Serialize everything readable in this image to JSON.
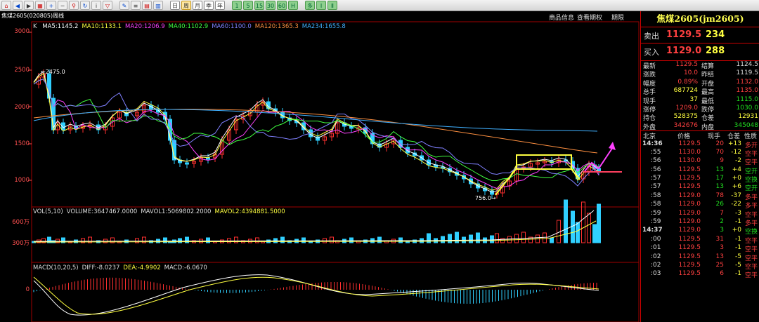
{
  "toolbar": {
    "icons": [
      "home-icon",
      "back-icon",
      "forward-icon",
      "grid-icon",
      "zoom-in-icon",
      "zoom-out-icon",
      "search-icon",
      "refresh-icon",
      "info-icon",
      "filter-icon",
      "tools-icon",
      "list-icon",
      "stats-icon",
      "calendar-icon"
    ],
    "periods": [
      "日",
      "周",
      "月",
      "季",
      "年",
      "1",
      "5",
      "15",
      "30",
      "60",
      "H",
      "多",
      "Ⅰ",
      "Ⅱ"
    ]
  },
  "header": {
    "symbol_label": "焦煤2605",
    "code": "(020805)",
    "period": "周线",
    "links": [
      "商品信息",
      "查看期权",
      "期限"
    ]
  },
  "main_indicators": {
    "prefix": "K",
    "items": [
      {
        "text": "MA5:1145.2",
        "color": "#ffffff"
      },
      {
        "text": "MA10:1133.1",
        "color": "#ffff40"
      },
      {
        "text": "MA20:1206.9",
        "color": "#ff40ff"
      },
      {
        "text": "MA40:1102.9",
        "color": "#40ff40"
      },
      {
        "text": "MA60:1100.0",
        "color": "#8080ff"
      },
      {
        "text": "MA120:1365.3",
        "color": "#ff9040"
      },
      {
        "text": "MA234:1655.8",
        "color": "#40b0ff"
      }
    ]
  },
  "price_axis": [
    "3000",
    "2500",
    "2000",
    "1500",
    "1000"
  ],
  "annotations": {
    "high": "2475.0",
    "low": "756.0"
  },
  "vol_indicators": {
    "items": [
      {
        "text": "VOL(5,10)",
        "color": "#dddddd"
      },
      {
        "text": "VOLUME:3647467.0000",
        "color": "#dddddd"
      },
      {
        "text": "MAVOL1:5069802.2000",
        "color": "#dddddd"
      },
      {
        "text": "MAVOL2:4394881.5000",
        "color": "#ffff40"
      }
    ],
    "axis": [
      "600万",
      "300万"
    ]
  },
  "macd_indicators": {
    "items": [
      {
        "text": "MACD(10,20,5)",
        "color": "#dddddd"
      },
      {
        "text": "DIFF:-8.0237",
        "color": "#dddddd"
      },
      {
        "text": "DEA:-4.9902",
        "color": "#ffff40"
      },
      {
        "text": "MACD:-6.0670",
        "color": "#dddddd"
      }
    ],
    "axis": [
      "0"
    ]
  },
  "colors": {
    "up": "#ff3030",
    "down": "#30d0ff",
    "accent": "#ffff40"
  },
  "quote_panel": {
    "title": "焦煤2605(jm2605)",
    "sell": {
      "label": "卖出",
      "price": "1129.5",
      "volume": "234"
    },
    "buy": {
      "label": "买入",
      "price": "1129.0",
      "volume": "288"
    },
    "stats": [
      {
        "l1": "最新",
        "v1": "1129.5",
        "c1": "red",
        "l2": "结算",
        "v2": "1124.5",
        "c2": "wht"
      },
      {
        "l1": "涨跌",
        "v1": "10.0",
        "c1": "red",
        "l2": "昨结",
        "v2": "1119.5",
        "c2": "wht"
      },
      {
        "l1": "幅度",
        "v1": "0.89%",
        "c1": "red",
        "l2": "开盘",
        "v2": "1132.0",
        "c2": "red"
      },
      {
        "l1": "总手",
        "v1": "687724",
        "c1": "yel",
        "l2": "最高",
        "v2": "1135.0",
        "c2": "red"
      },
      {
        "l1": "现手",
        "v1": "37",
        "c1": "yel",
        "l2": "最低",
        "v2": "1115.0",
        "c2": "grn"
      },
      {
        "l1": "涨停",
        "v1": "1209.0",
        "c1": "red",
        "l2": "跌停",
        "v2": "1030.0",
        "c2": "grn"
      },
      {
        "l1": "持仓",
        "v1": "528375",
        "c1": "yel",
        "l2": "仓差",
        "v2": "12931",
        "c2": "yel"
      },
      {
        "l1": "外盘",
        "v1": "342676",
        "c1": "red",
        "l2": "内盘",
        "v2": "345048",
        "c2": "grn"
      }
    ],
    "ticks_header": [
      "北京",
      "价格",
      "现手",
      "仓差",
      "性质"
    ],
    "ticks": [
      {
        "time": "14:36",
        "price": "1129.5",
        "pc": "red",
        "hand": "20",
        "hc": "red",
        "diff": "+13",
        "dc": "yel",
        "nature": "多开",
        "nc": "red",
        "bold": true
      },
      {
        "time": ":55",
        "price": "1130.0",
        "pc": "red",
        "hand": "70",
        "hc": "red",
        "diff": "-12",
        "dc": "yel",
        "nature": "空平",
        "nc": "red"
      },
      {
        "time": ":56",
        "price": "1130.0",
        "pc": "red",
        "hand": "9",
        "hc": "red",
        "diff": "-2",
        "dc": "yel",
        "nature": "空平",
        "nc": "red"
      },
      {
        "time": ":56",
        "price": "1129.5",
        "pc": "red",
        "hand": "13",
        "hc": "grn",
        "diff": "+4",
        "dc": "yel",
        "nature": "空开",
        "nc": "grn"
      },
      {
        "time": ":57",
        "price": "1129.5",
        "pc": "red",
        "hand": "17",
        "hc": "grn",
        "diff": "+0",
        "dc": "yel",
        "nature": "空换",
        "nc": "grn"
      },
      {
        "time": ":57",
        "price": "1129.5",
        "pc": "red",
        "hand": "13",
        "hc": "grn",
        "diff": "+6",
        "dc": "yel",
        "nature": "空开",
        "nc": "grn"
      },
      {
        "time": ":58",
        "price": "1129.0",
        "pc": "red",
        "hand": "78",
        "hc": "red",
        "diff": "-37",
        "dc": "yel",
        "nature": "多平",
        "nc": "red"
      },
      {
        "time": ":58",
        "price": "1129.0",
        "pc": "red",
        "hand": "26",
        "hc": "grn",
        "diff": "-22",
        "dc": "yel",
        "nature": "多平",
        "nc": "red"
      },
      {
        "time": ":59",
        "price": "1129.0",
        "pc": "red",
        "hand": "7",
        "hc": "red",
        "diff": "-3",
        "dc": "yel",
        "nature": "空平",
        "nc": "red"
      },
      {
        "time": ":59",
        "price": "1129.0",
        "pc": "red",
        "hand": "2",
        "hc": "grn",
        "diff": "-1",
        "dc": "yel",
        "nature": "多平",
        "nc": "red"
      },
      {
        "time": "14:37",
        "price": "1129.0",
        "pc": "red",
        "hand": "3",
        "hc": "grn",
        "diff": "+0",
        "dc": "yel",
        "nature": "空换",
        "nc": "grn",
        "bold": true
      },
      {
        "time": ":00",
        "price": "1129.5",
        "pc": "red",
        "hand": "31",
        "hc": "red",
        "diff": "-1",
        "dc": "yel",
        "nature": "空平",
        "nc": "red"
      },
      {
        "time": ":01",
        "price": "1129.5",
        "pc": "red",
        "hand": "3",
        "hc": "red",
        "diff": "-1",
        "dc": "yel",
        "nature": "空平",
        "nc": "red"
      },
      {
        "time": ":02",
        "price": "1129.5",
        "pc": "red",
        "hand": "13",
        "hc": "red",
        "diff": "-5",
        "dc": "yel",
        "nature": "空平",
        "nc": "red"
      },
      {
        "time": ":02",
        "price": "1129.5",
        "pc": "red",
        "hand": "25",
        "hc": "red",
        "diff": "-5",
        "dc": "yel",
        "nature": "空平",
        "nc": "red"
      },
      {
        "time": ":03",
        "price": "1129.5",
        "pc": "red",
        "hand": "6",
        "hc": "red",
        "diff": "-1",
        "dc": "yel",
        "nature": "空平",
        "nc": "red"
      }
    ]
  }
}
